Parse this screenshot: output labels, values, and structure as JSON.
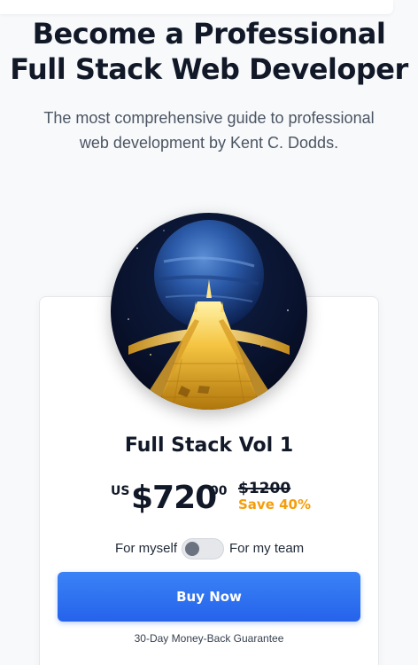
{
  "header": {
    "title_line1": "Become a Professional",
    "title_line2": "Full Stack Web Developer",
    "subtitle_line1": "The most comprehensive guide to professional",
    "subtitle_line2": "web development by Kent C. Dodds."
  },
  "product": {
    "title": "Full Stack Vol 1",
    "currency": "US",
    "price": "$720",
    "cents": "00",
    "original_price": "$1200",
    "discount": "Save 40%",
    "image_icon": "planet-road-cover"
  },
  "purchase": {
    "toggle_left_label": "For myself",
    "toggle_right_label": "For my team",
    "toggle_on": false,
    "buy_label": "Buy Now",
    "guarantee": "30-Day Money-Back Guarantee"
  },
  "colors": {
    "accent": "#2563eb",
    "discount": "#f59e0b",
    "text": "#111827"
  }
}
